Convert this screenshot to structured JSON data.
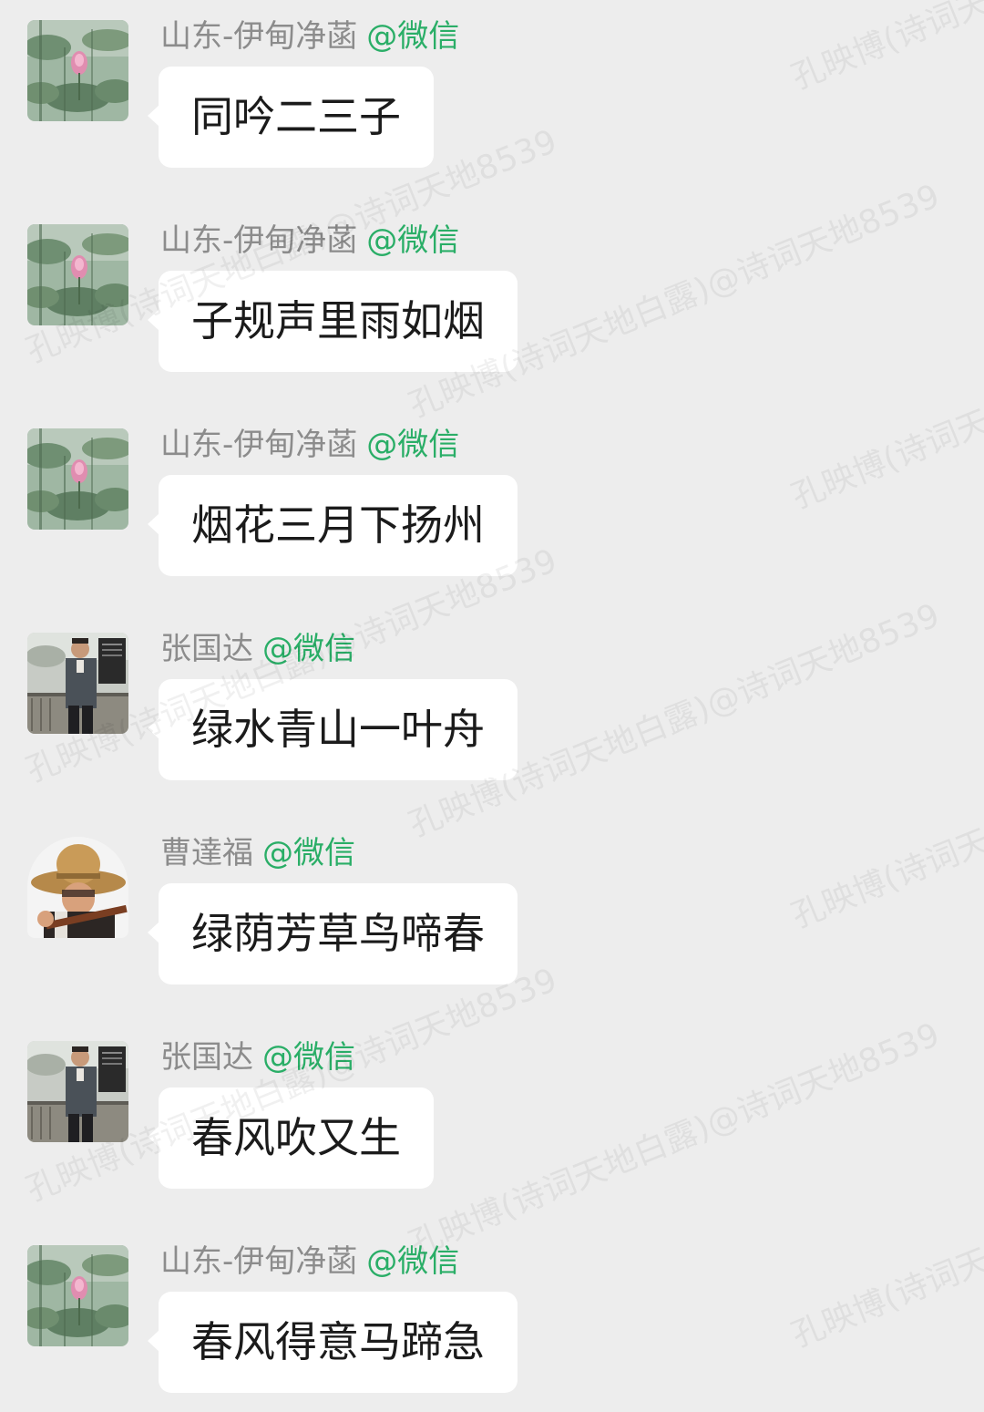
{
  "watermark": "孔映博(诗词天地白露)@诗词天地8539",
  "messages": [
    {
      "sender": "山东-伊甸净菡",
      "platform_tag": "@微信",
      "text": "同吟二三子",
      "avatar_icon": "lotus-avatar-icon"
    },
    {
      "sender": "山东-伊甸净菡",
      "platform_tag": "@微信",
      "text": "子规声里雨如烟",
      "avatar_icon": "lotus-avatar-icon"
    },
    {
      "sender": "山东-伊甸净菡",
      "platform_tag": "@微信",
      "text": "烟花三月下扬州",
      "avatar_icon": "lotus-avatar-icon"
    },
    {
      "sender": "张国达",
      "platform_tag": "@微信",
      "text": "绿水青山一叶舟",
      "avatar_icon": "man-portrait-avatar-icon"
    },
    {
      "sender": "曹達福",
      "platform_tag": "@微信",
      "text": "绿荫芳草鸟啼春",
      "avatar_icon": "straw-hat-avatar-icon"
    },
    {
      "sender": "张国达",
      "platform_tag": "@微信",
      "text": "春风吹又生",
      "avatar_icon": "man-portrait-avatar-icon"
    },
    {
      "sender": "山东-伊甸净菡",
      "platform_tag": "@微信",
      "text": "春风得意马蹄急",
      "avatar_icon": "lotus-avatar-icon"
    }
  ],
  "colors": {
    "background": "#ededed",
    "bubble": "#ffffff",
    "sender_name": "#8c8c8c",
    "platform_tag": "#2aae67",
    "message_text": "#1b1b1b"
  }
}
